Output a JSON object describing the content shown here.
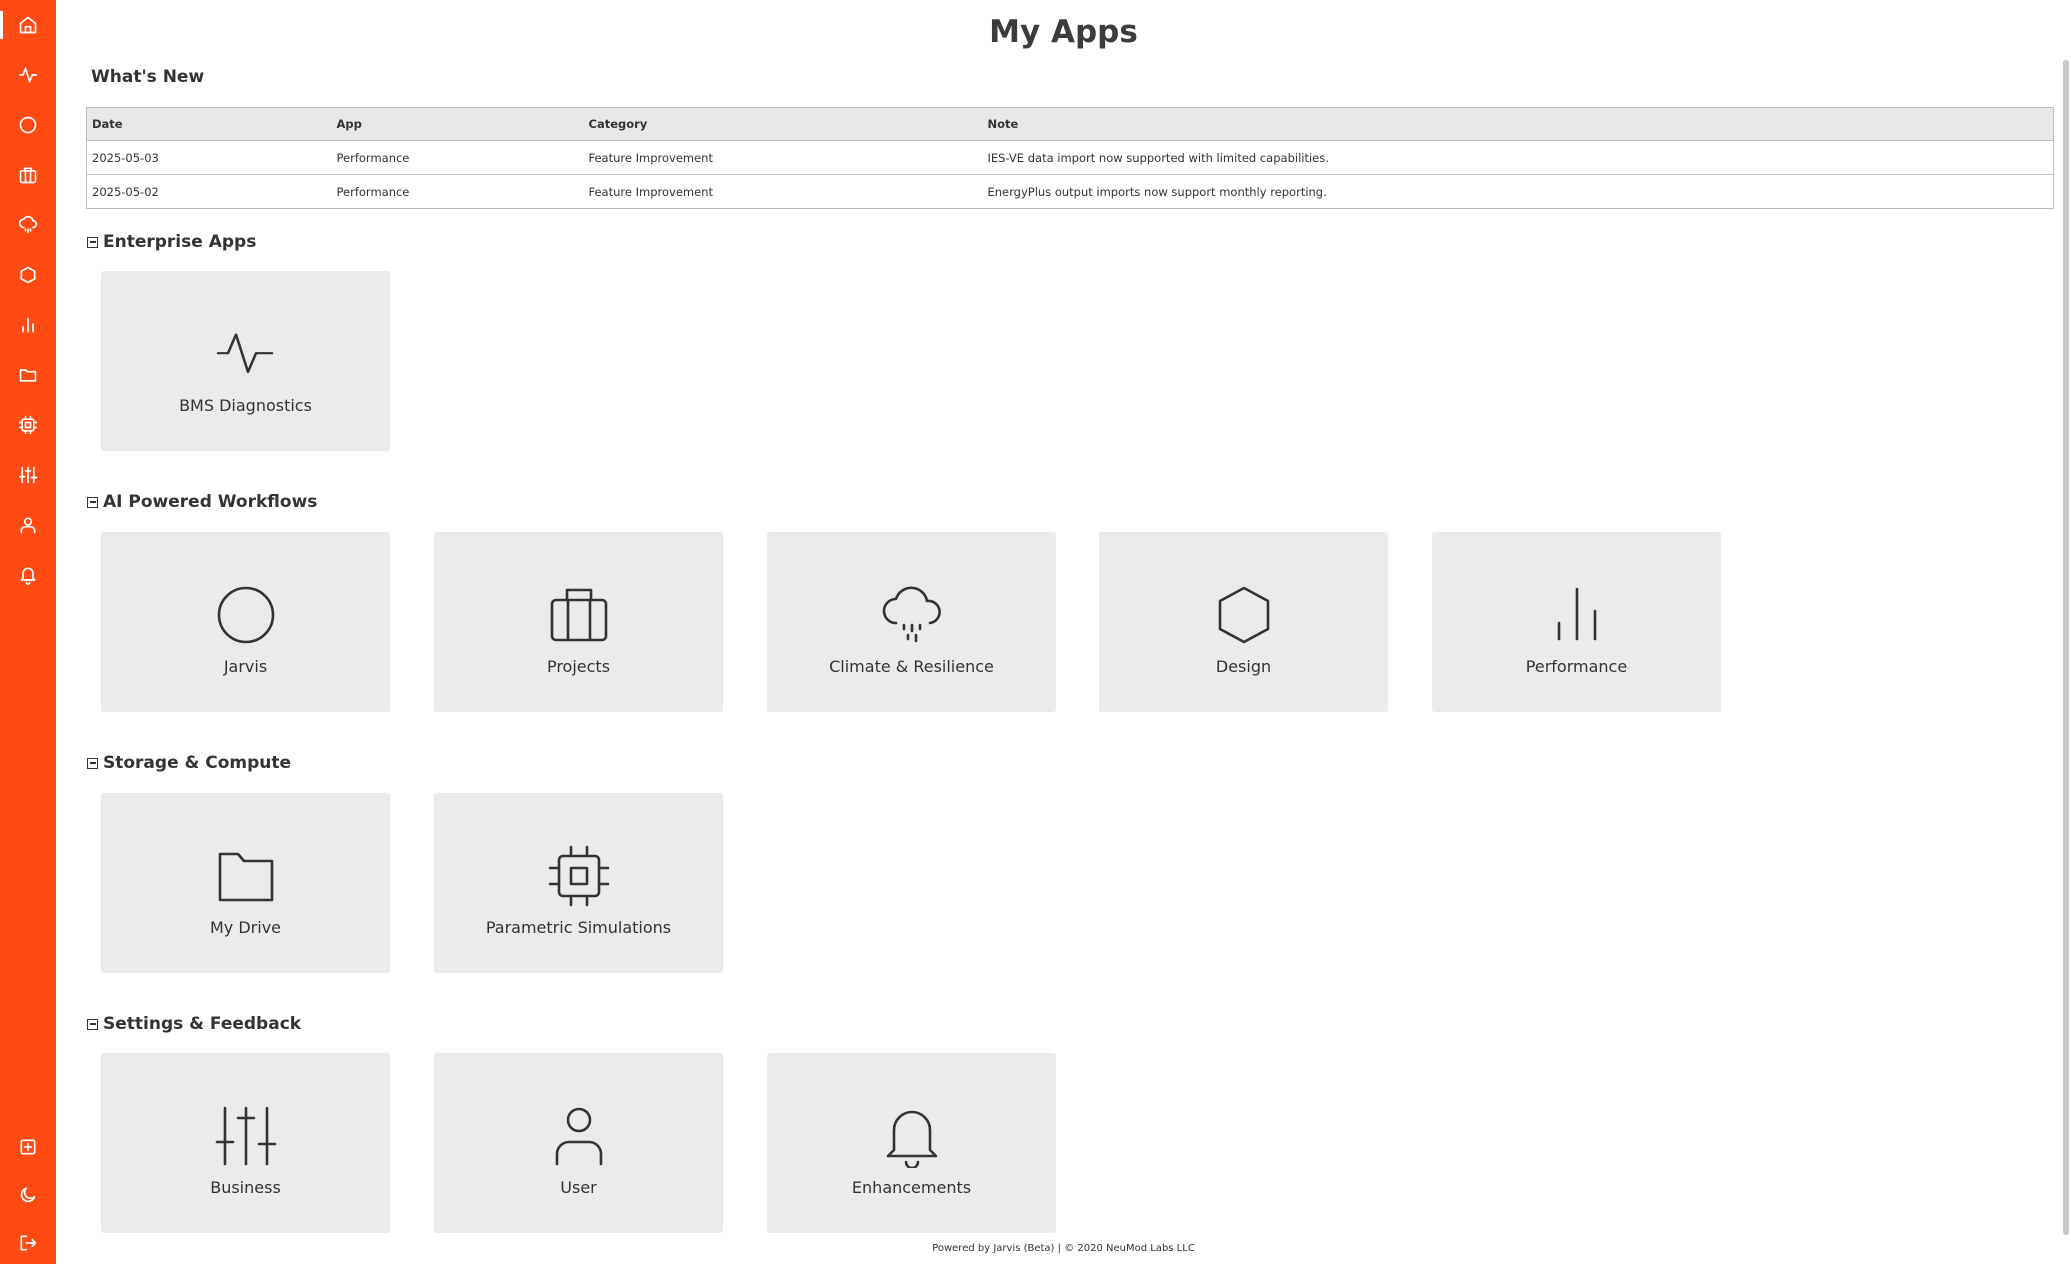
{
  "page": {
    "title": "My Apps",
    "footer": "Powered by Jarvis (Beta) | © 2020 NeuMod Labs LLC"
  },
  "colors": {
    "sidebar": "#ff4a14",
    "tile": "#ebebeb",
    "text": "#333333"
  },
  "sidebar": {
    "items": [
      {
        "icon": "home-icon"
      },
      {
        "icon": "activity-icon"
      },
      {
        "icon": "circle-icon"
      },
      {
        "icon": "briefcase-icon"
      },
      {
        "icon": "cloud-rain-icon"
      },
      {
        "icon": "hexagon-icon"
      },
      {
        "icon": "bar-chart-icon"
      },
      {
        "icon": "folder-icon"
      },
      {
        "icon": "cpu-icon"
      },
      {
        "icon": "sliders-icon"
      },
      {
        "icon": "user-icon"
      },
      {
        "icon": "bell-icon"
      }
    ],
    "bottom_items": [
      {
        "icon": "calculator-icon"
      },
      {
        "icon": "moon-icon"
      },
      {
        "icon": "logout-icon"
      }
    ]
  },
  "whats_new": {
    "title": "What's New",
    "columns": [
      "Date",
      "App",
      "Category",
      "Note"
    ],
    "rows": [
      [
        "2025-05-03",
        "Performance",
        "Feature Improvement",
        "IES-VE data import now supported with limited capabilities."
      ],
      [
        "2025-05-02",
        "Performance",
        "Feature Improvement",
        "EnergyPlus output imports now support monthly reporting."
      ]
    ]
  },
  "groups": {
    "enterprise": {
      "title": "Enterprise Apps",
      "apps": [
        {
          "label": "BMS Diagnostics",
          "icon": "activity-icon"
        }
      ]
    },
    "ai": {
      "title": "AI Powered Workflows",
      "apps": [
        {
          "label": "Jarvis",
          "icon": "circle-icon"
        },
        {
          "label": "Projects",
          "icon": "briefcase-icon"
        },
        {
          "label": "Climate & Resilience",
          "icon": "cloud-rain-icon"
        },
        {
          "label": "Design",
          "icon": "hexagon-icon"
        },
        {
          "label": "Performance",
          "icon": "bar-chart-icon"
        }
      ]
    },
    "storage": {
      "title": "Storage & Compute",
      "apps": [
        {
          "label": "My Drive",
          "icon": "folder-icon"
        },
        {
          "label": "Parametric Simulations",
          "icon": "cpu-icon"
        }
      ]
    },
    "settings": {
      "title": "Settings & Feedback",
      "apps": [
        {
          "label": "Business",
          "icon": "sliders-icon"
        },
        {
          "label": "User",
          "icon": "user-icon"
        },
        {
          "label": "Enhancements",
          "icon": "bell-icon"
        }
      ]
    }
  }
}
